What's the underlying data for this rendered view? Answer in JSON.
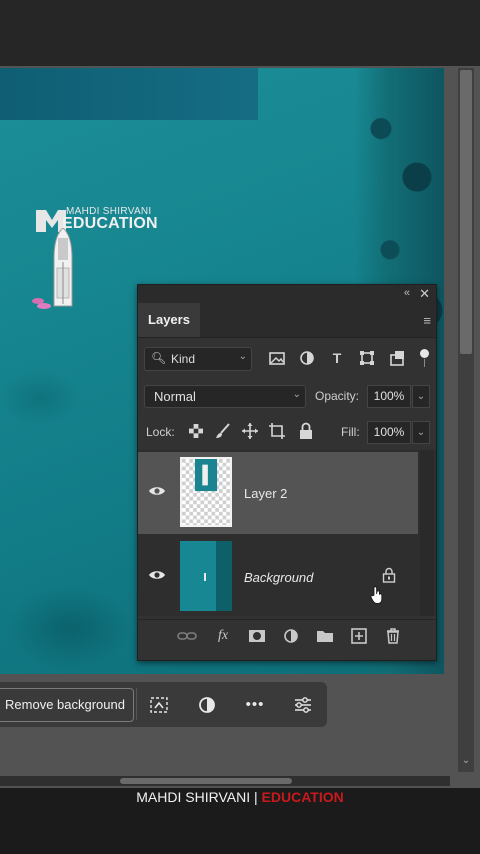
{
  "colors": {
    "accent": "#c8191d",
    "panel_bg": "#323232",
    "selected_layer": "#545454",
    "canvas_water": "#15838d"
  },
  "watermark": {
    "name": "MAHDI SHIRVANI",
    "brand": "EDUCATION"
  },
  "layers_panel": {
    "tab_label": "Layers",
    "filter": {
      "label": "Kind",
      "icons": [
        "image-filter-icon",
        "adjustment-filter-icon",
        "type-filter-icon",
        "shape-filter-icon",
        "smart-object-filter-icon"
      ]
    },
    "blend_mode": "Normal",
    "opacity_label": "Opacity:",
    "opacity_value": "100%",
    "lock_label": "Lock:",
    "fill_label": "Fill:",
    "fill_value": "100%",
    "layers": [
      {
        "name": "Layer 2",
        "selected": true,
        "visible": true,
        "locked": false
      },
      {
        "name": "Background",
        "selected": false,
        "visible": true,
        "locked": true
      }
    ]
  },
  "task_bar": {
    "remove_background_label": "Remove background",
    "more_label": "•••"
  },
  "footer": {
    "credit_name": "MAHDI SHIRVANI",
    "separator": "|",
    "credit_brand": "EDUCATION"
  }
}
